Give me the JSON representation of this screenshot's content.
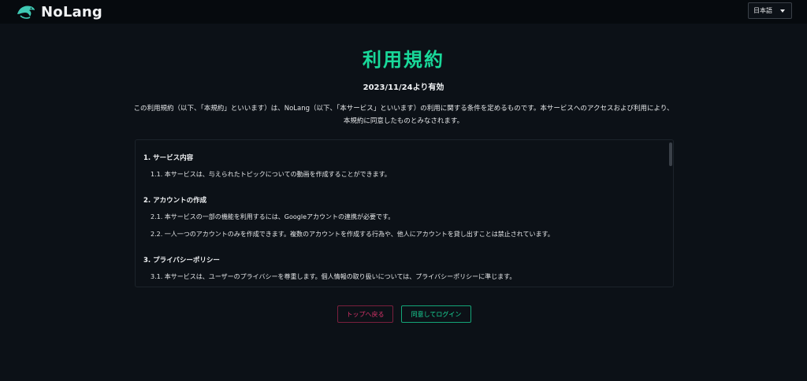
{
  "header": {
    "brand": "NoLang",
    "language_selected": "日本語"
  },
  "main": {
    "title": "利用規約",
    "effective_date": "2023/11/24より有効",
    "intro": "この利用規約（以下、「本規約」といいます）は、NoLang（以下、「本サービス」といいます）の利用に関する条件を定めるものです。本サービスへのアクセスおよび利用により、本規約に同意したものとみなされます。"
  },
  "terms": {
    "sections": [
      {
        "heading": "1. サービス内容",
        "clauses": [
          "1.1. 本サービスは、与えられたトピックについての動画を作成することができます。"
        ]
      },
      {
        "heading": "2. アカウントの作成",
        "clauses": [
          "2.1. 本サービスの一部の機能を利用するには、Googleアカウントの連携が必要です。",
          "2.2. 一人一つのアカウントのみを作成できます。複数のアカウントを作成する行為や、他人にアカウントを貸し出すことは禁止されています。"
        ]
      },
      {
        "heading": "3. プライバシーポリシー",
        "clauses": [
          "3.1. 本サービスは、ユーザーのプライバシーを尊重します。個人情報の取り扱いについては、プライバシーポリシーに準じます。"
        ]
      }
    ]
  },
  "actions": {
    "back_label": "トップへ戻る",
    "agree_label": "同意してログイン"
  },
  "colors": {
    "background": "#0c1117",
    "accent": "#19d99a",
    "danger": "#d8336a"
  },
  "icons": {
    "logo": "dolphin-logo-icon",
    "dropdown": "chevron-down-icon"
  }
}
